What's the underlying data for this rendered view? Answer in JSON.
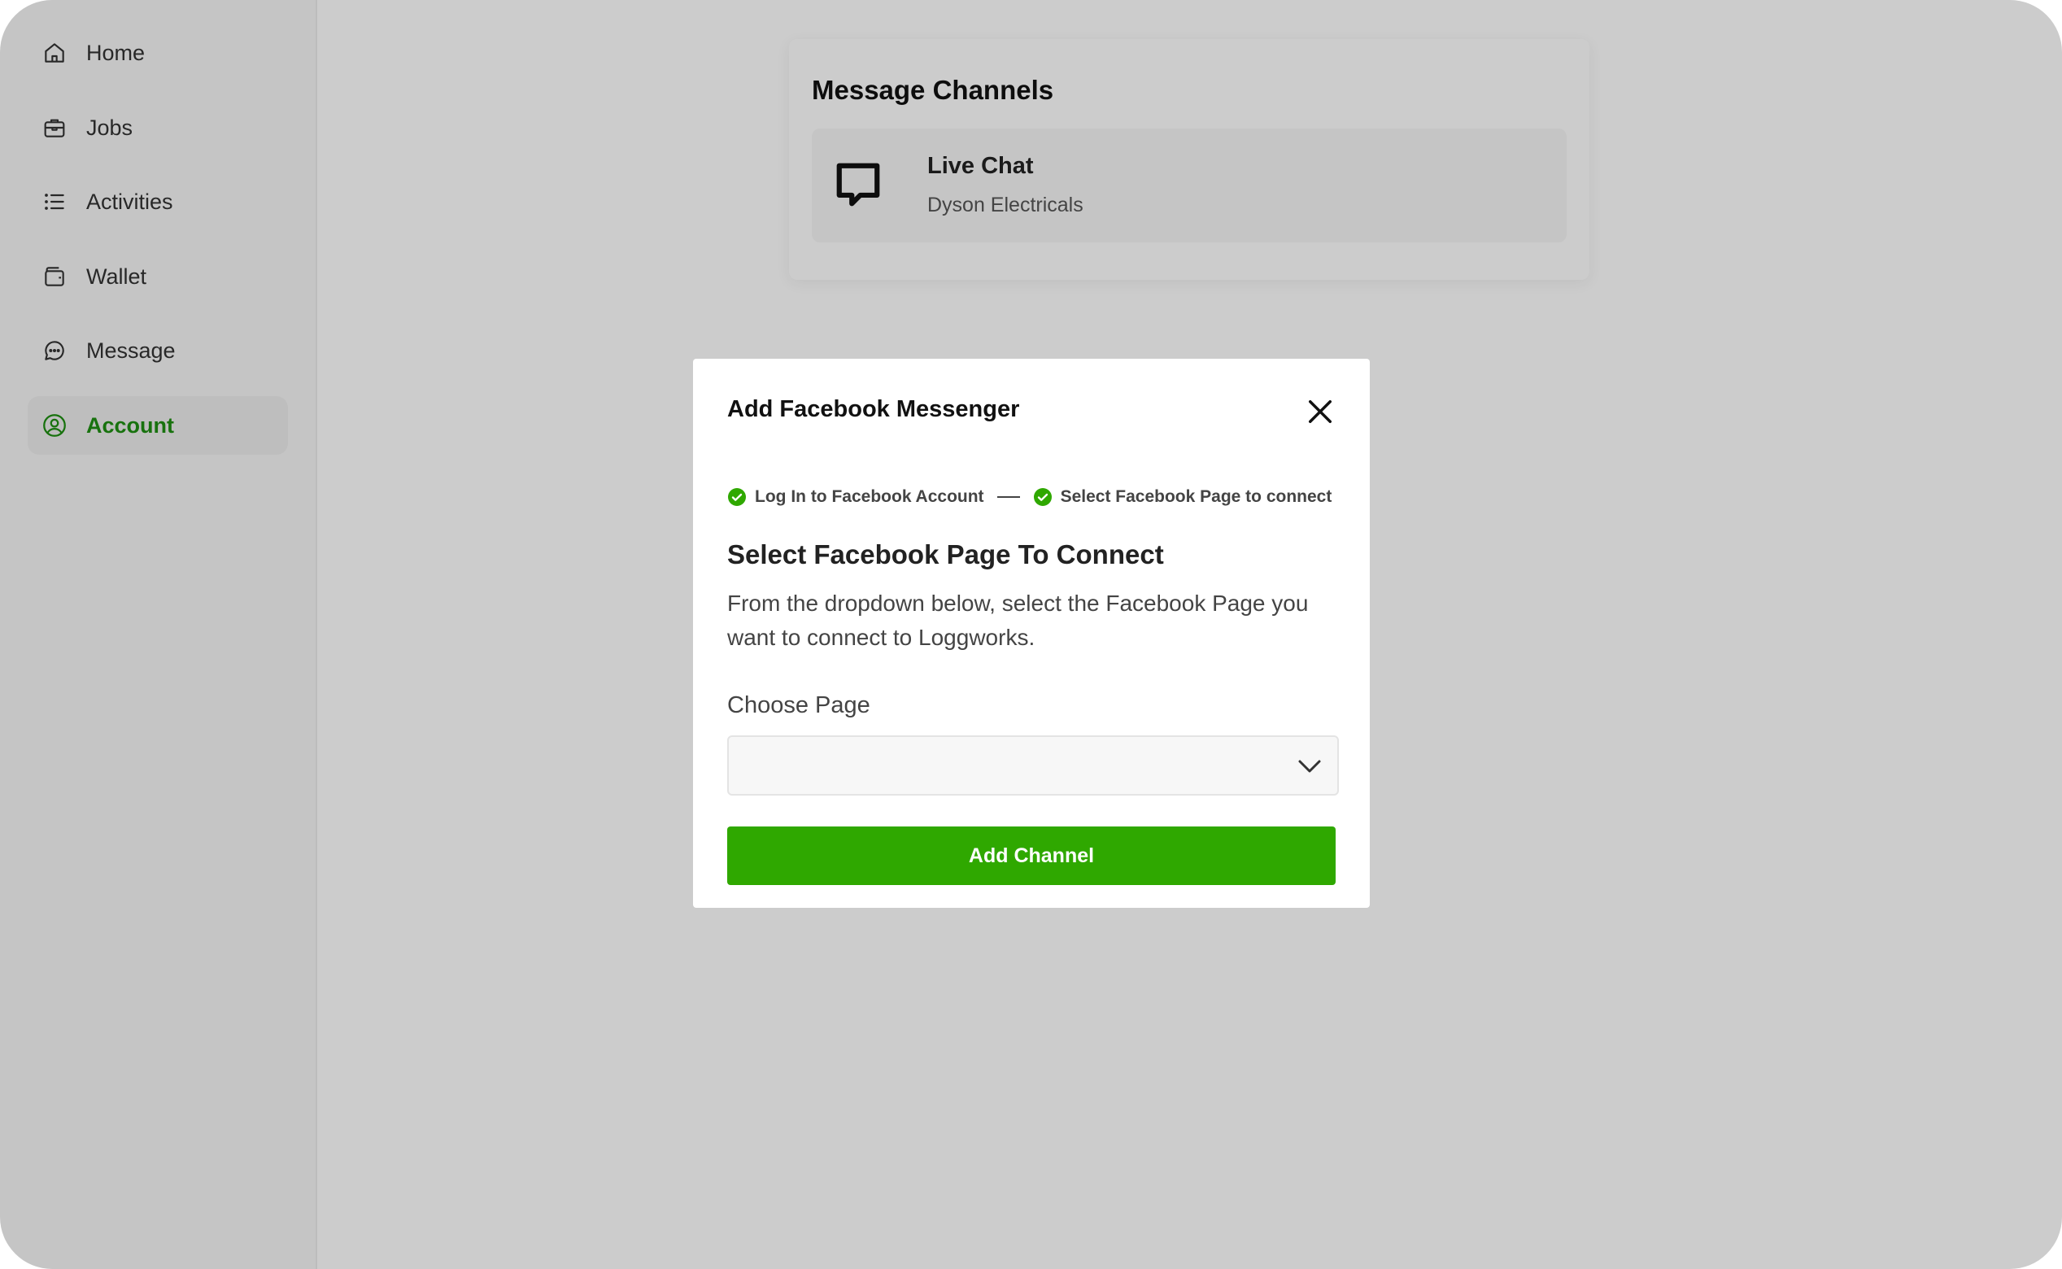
{
  "sidebar": {
    "items": [
      {
        "label": "Home",
        "icon": "home-icon",
        "active": false
      },
      {
        "label": "Jobs",
        "icon": "briefcase-icon",
        "active": false
      },
      {
        "label": "Activities",
        "icon": "list-icon",
        "active": false
      },
      {
        "label": "Wallet",
        "icon": "wallet-icon",
        "active": false
      },
      {
        "label": "Message",
        "icon": "message-icon",
        "active": false
      },
      {
        "label": "Account",
        "icon": "user-circle-icon",
        "active": true
      }
    ]
  },
  "main": {
    "title": "Message Channels",
    "channels": [
      {
        "name": "Live Chat",
        "subtitle": "Dyson Electricals",
        "icon": "chat-bubble-icon"
      }
    ]
  },
  "modal": {
    "title": "Add Facebook Messenger",
    "steps": [
      {
        "label": "Log In to Facebook Account",
        "done": true
      },
      {
        "label": "Select Facebook Page to connect",
        "done": true
      }
    ],
    "section_title": "Select Facebook Page To Connect",
    "section_desc": "From the dropdown below, select the Facebook Page you want to connect to Loggworks.",
    "field_label": "Choose Page",
    "select_value": "",
    "add_button": "Add Channel"
  },
  "colors": {
    "accent": "#2fa800",
    "active_nav": "#1f8f12",
    "overlay": "rgba(0,0,0,0.2)"
  }
}
